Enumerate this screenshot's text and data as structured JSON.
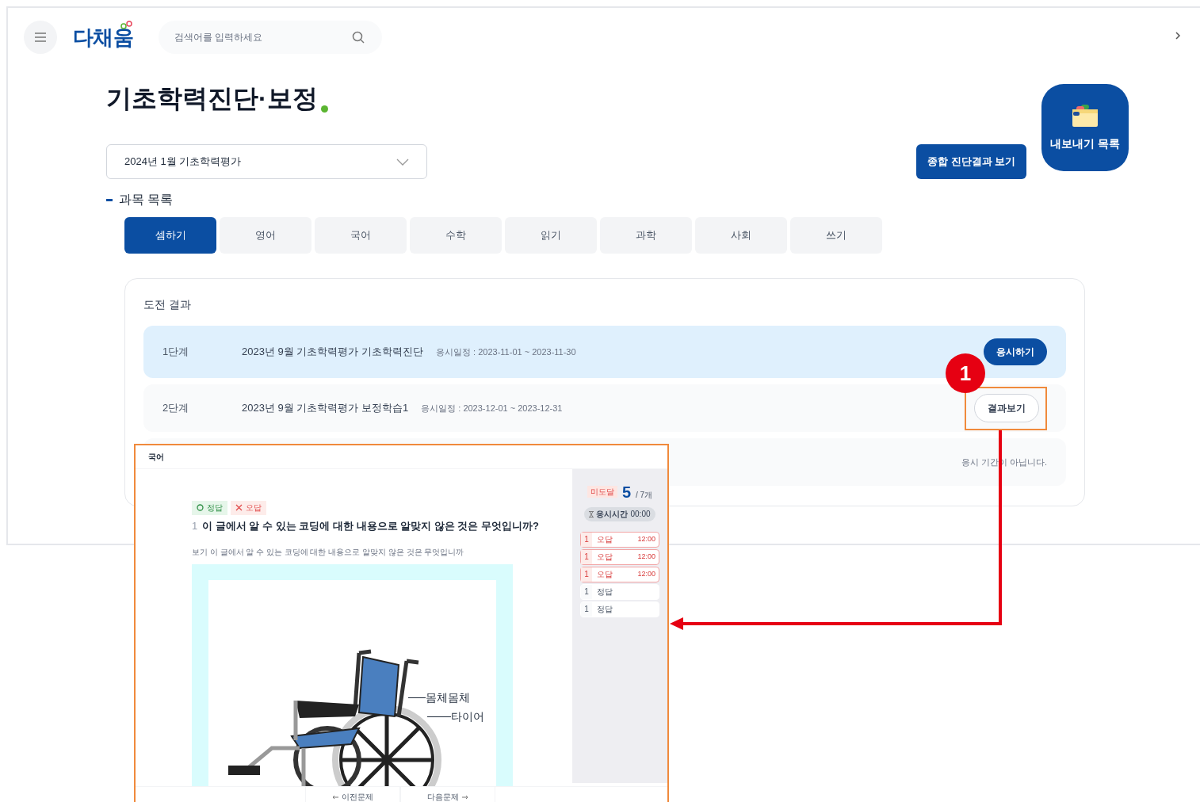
{
  "header": {
    "logo": "다채움",
    "search": {
      "placeholder": "검색어를 입력하세요"
    }
  },
  "page_title": "기초학력진단·보정",
  "exam_select": {
    "value": "2024년 1월 기초학력평가"
  },
  "summary_button": "종합 진단결과 보기",
  "export_button": "내보내기 목록",
  "section_title": "과목 목록",
  "subject_tabs": [
    {
      "label": "셈하기",
      "selected": true
    },
    {
      "label": "영어",
      "selected": false
    },
    {
      "label": "국어",
      "selected": false
    },
    {
      "label": "수학",
      "selected": false
    },
    {
      "label": "읽기",
      "selected": false
    },
    {
      "label": "과학",
      "selected": false
    },
    {
      "label": "사회",
      "selected": false
    },
    {
      "label": "쓰기",
      "selected": false
    }
  ],
  "results": {
    "title": "도전 결과",
    "rows": [
      {
        "kind": "start",
        "highlighted": true,
        "stage": "1단계",
        "name": "2023년 9월 기초학력평가 기초학력진단",
        "schedule": "응시일정 : 2023-11-01 ~ 2023-11-30",
        "action": "응시하기"
      },
      {
        "kind": "result",
        "highlighted": false,
        "stage": "2단계",
        "name": "2023년 9월 기초학력평가 보정학습1",
        "schedule": "응시일정 : 2023-12-01 ~ 2023-12-31",
        "action": "결과보기"
      },
      {
        "kind": "notice",
        "highlighted": false,
        "action": "응시 기간이 아닙니다."
      }
    ]
  },
  "callout": {
    "number": "1"
  },
  "preview": {
    "title": "국어",
    "legend": [
      {
        "kind": "correct",
        "label": "정답"
      },
      {
        "kind": "wrong",
        "label": "오답"
      }
    ],
    "question_number": "1",
    "question": "이 글에서 알 수 있는 코딩에 대한 내용으로 알맞지 않은 것은 무엇입니까?",
    "hint": "보기 이 글에서 알 수 있는 코딩에 대한 내용으로 알맞지 않은 것은 무엇입니까",
    "figure_labels": [
      "몸체몸체",
      "타이어"
    ],
    "nav": [
      {
        "kind": "prev",
        "label": "이전문제"
      },
      {
        "kind": "next",
        "label": "다음문제"
      }
    ],
    "badge": "미도달",
    "score": "5",
    "total": "/ 7개",
    "time_label": "응시시간",
    "time": "00:00",
    "answers": [
      {
        "kind": "wrong",
        "number": "1",
        "result": "오답",
        "time": "12:00"
      },
      {
        "kind": "wrong",
        "number": "1",
        "result": "오답",
        "time": "12:00"
      },
      {
        "kind": "wrong",
        "number": "1",
        "result": "오답",
        "time": "12:00"
      },
      {
        "kind": "correct",
        "number": "1",
        "result": "정답"
      },
      {
        "kind": "correct",
        "number": "1",
        "result": "정답"
      }
    ]
  }
}
